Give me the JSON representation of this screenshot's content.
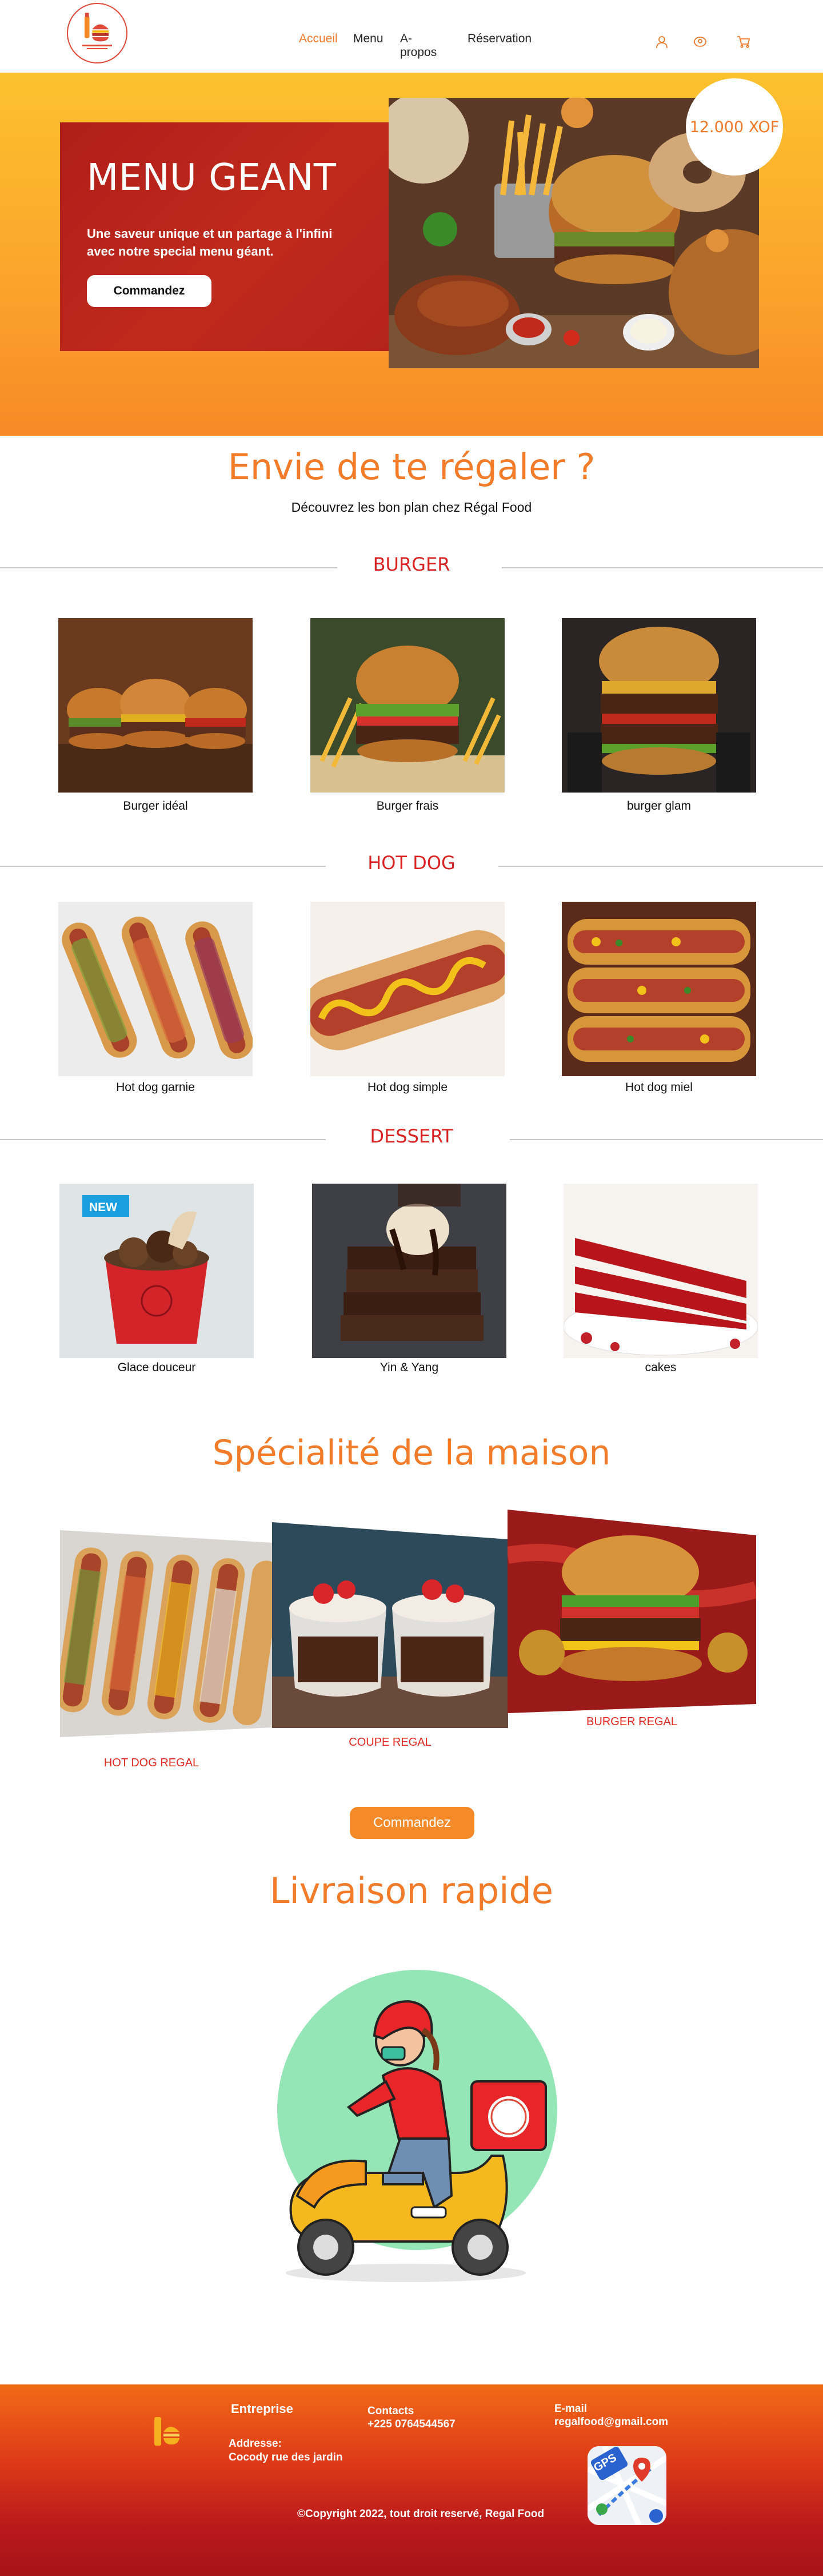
{
  "nav": {
    "items": [
      "Accueil",
      "Menu",
      "A-propos",
      "Réservation"
    ],
    "active": "Accueil",
    "icons": [
      "user-icon",
      "location-icon",
      "cart-icon"
    ]
  },
  "hero": {
    "title": "MENU GEANT",
    "description": "Une saveur unique et un partage à l'infini avec notre special menu géant.",
    "button": "Commandez",
    "price": "12.000 XOF"
  },
  "intro": {
    "title": "Envie de te régaler ?",
    "subtitle": "Découvrez les bon plan chez Régal Food"
  },
  "categories": [
    {
      "name": "BURGER",
      "items": [
        "Burger idéal",
        "Burger frais",
        "burger glam"
      ]
    },
    {
      "name": "HOT DOG",
      "items": [
        "Hot dog garnie",
        "Hot dog simple",
        "Hot dog miel"
      ]
    },
    {
      "name": "DESSERT",
      "items": [
        "Glace douceur",
        "Yin & Yang",
        "cakes"
      ]
    }
  ],
  "badge_new": "NEW",
  "specialite": {
    "title": "Spécialité de la maison",
    "items": [
      "HOT DOG REGAL",
      "COUPE REGAL",
      "BURGER REGAL"
    ],
    "button": "Commandez"
  },
  "delivery": {
    "title": "Livraison rapide"
  },
  "footer": {
    "entreprise": "Entreprise",
    "contacts_label": "Contacts",
    "phone": "+225 0764544567",
    "email_label": "E-mail",
    "email": "regalfood@gmail.com",
    "address_label": "Addresse:",
    "address": "Cocody rue des jardin",
    "copyright": "©Copyright 2022, tout droit reservé, Regal Food",
    "gps_label": "GPS"
  },
  "colors": {
    "accent": "#f27c29",
    "red": "#d92222",
    "hero_card": "#b01e1a"
  }
}
